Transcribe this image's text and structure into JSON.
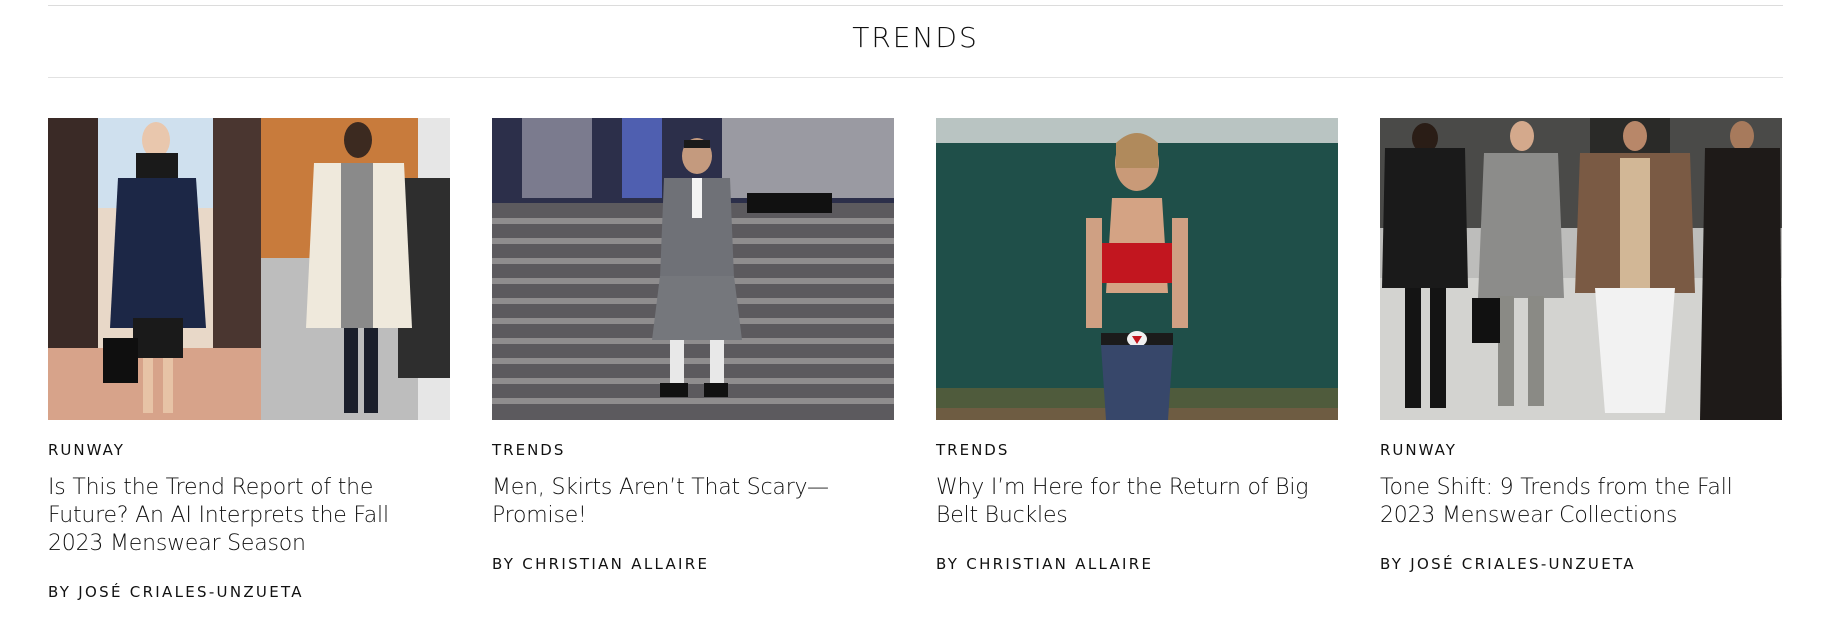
{
  "section": {
    "title": "TRENDS"
  },
  "cards": [
    {
      "image": "runway-models-photo",
      "rubric": "RUNWAY",
      "headline": "Is This the Trend Report of the Future? An AI Interprets the Fall 2023 Menswear Season",
      "byline": "BY JOSÉ CRIALES-UNZUETA"
    },
    {
      "image": "man-in-kilt-photo",
      "rubric": "TRENDS",
      "headline": "Men, Skirts Aren’t That Scary—Promise!",
      "byline": "BY CHRISTIAN ALLAIRE"
    },
    {
      "image": "woman-big-belt-buckle-photo",
      "rubric": "TRENDS",
      "headline": "Why I’m Here for the Return of Big Belt Buckles",
      "byline": "BY CHRISTIAN ALLAIRE"
    },
    {
      "image": "menswear-runway-photo",
      "rubric": "RUNWAY",
      "headline": "Tone Shift: 9 Trends from the Fall 2023 Menswear Collections",
      "byline": "BY JOSÉ CRIALES-UNZUETA"
    }
  ]
}
